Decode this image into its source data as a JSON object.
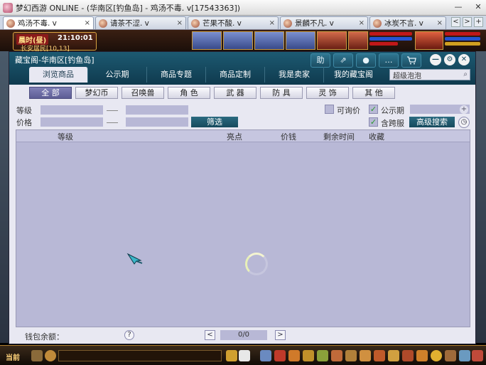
{
  "os_window": {
    "title": "梦幻西游 ONLINE - (华南区[钓鱼岛] - 鸡汤不毒. v[17543363])",
    "minimize": "—",
    "close": "✕"
  },
  "tabs": [
    {
      "label": "鸡汤不毒. v",
      "close": "×"
    },
    {
      "label": "请茶不涩. v",
      "close": "×"
    },
    {
      "label": "芒果不酸. v",
      "close": "×"
    },
    {
      "label": "景麟不凡. v",
      "close": "×"
    },
    {
      "label": "冰炭不言. v",
      "close": "×"
    }
  ],
  "tab_nav": {
    "add": "+",
    "prev": "<",
    "next": ">"
  },
  "hud": {
    "time_badge": "晨时(昼)",
    "time_clock": "21:10:01",
    "location": "长安居民[10,13]"
  },
  "dialog": {
    "title": "藏宝阁-华南区[钓鱼岛]",
    "tools": [
      {
        "icon": "help-icon",
        "glyph": "助"
      },
      {
        "icon": "share-icon",
        "glyph": "⇗"
      },
      {
        "icon": "record-icon",
        "glyph": "●"
      },
      {
        "icon": "chat-icon",
        "glyph": "…"
      },
      {
        "icon": "cart-icon",
        "glyph": "🛒"
      }
    ],
    "controls": {
      "minimize": "—",
      "settings": "⚙",
      "close": "✕"
    },
    "nav_tabs": [
      "浏览商品",
      "公示期",
      "商品专题",
      "商品定制",
      "我是卖家",
      "我的藏宝阁"
    ],
    "search": {
      "value": "超级泡泡",
      "icon": "⌕"
    }
  },
  "categories": [
    "全 部",
    "梦幻币",
    "召唤兽",
    "角 色",
    "武 器",
    "防 具",
    "灵 饰",
    "其 他"
  ],
  "filters": {
    "level_label": "等级",
    "price_label": "价格",
    "dash": "——",
    "filter_button": "筛选",
    "inquiry_label": "可询价",
    "inquiry_checked": false,
    "public_label": "公示期",
    "public_checked": true,
    "cross_label": "含跨服",
    "cross_checked": true,
    "advanced_search": "高级搜索",
    "plus": "+",
    "clock": "◷"
  },
  "table": {
    "headers": [
      "等级",
      "亮点",
      "价钱",
      "剩余时间",
      "收藏"
    ]
  },
  "footer": {
    "wallet_label": "钱包余额：",
    "help": "?",
    "prev": "<",
    "page": "0/0",
    "next": ">"
  },
  "gamebar": {
    "channel": "当前"
  },
  "colors": {
    "dialog_header": "#1d5a72",
    "panel_bg": "#e8e8f2",
    "table_bg": "#b8b8d6",
    "accent_button": "#164a5d",
    "active_category": "#6a6aa2"
  }
}
